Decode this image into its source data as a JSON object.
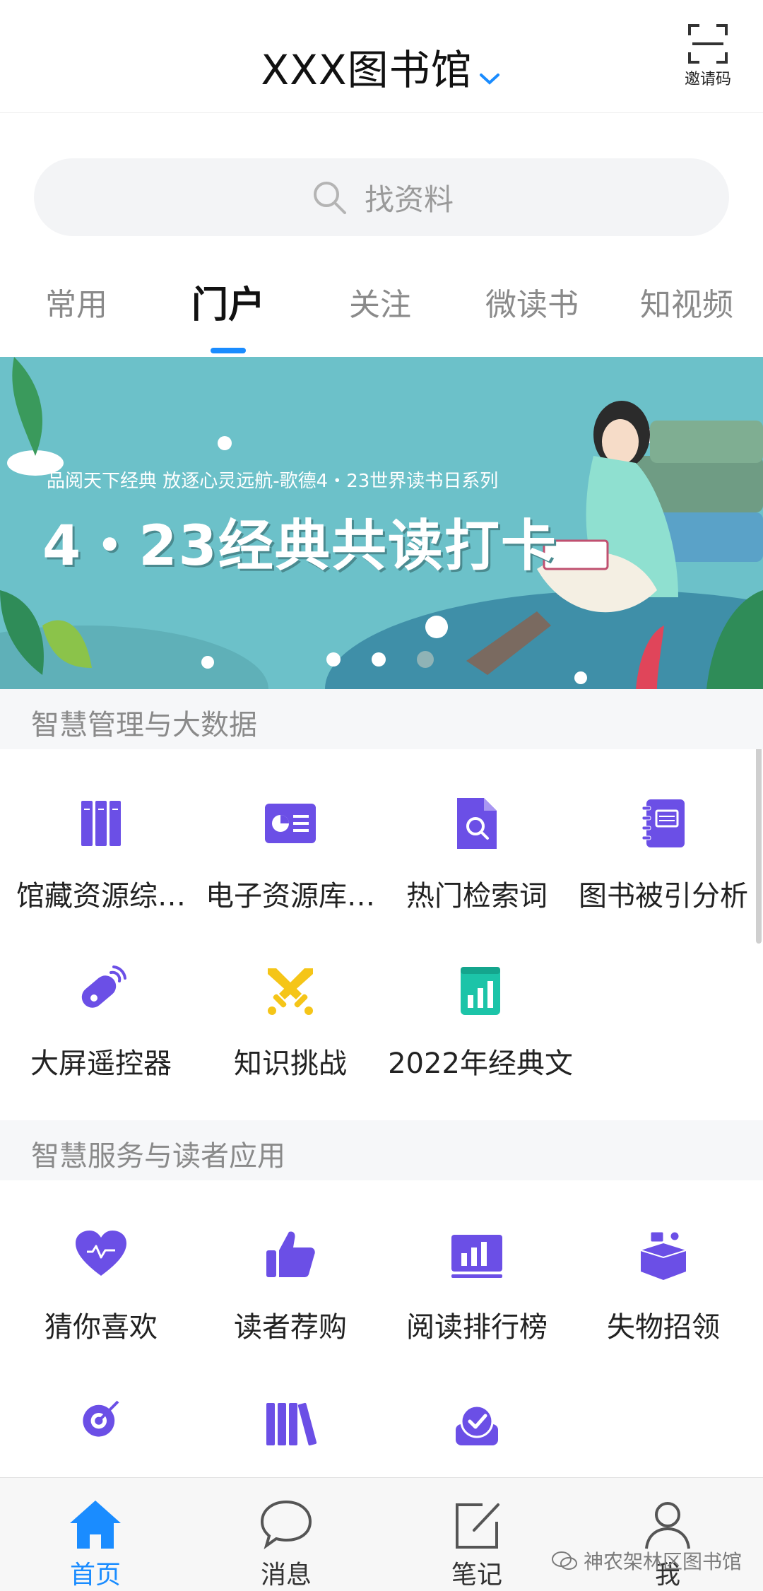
{
  "header": {
    "title": "XXX图书馆",
    "invite_label": "邀请码"
  },
  "search": {
    "placeholder": "找资料"
  },
  "tabs": [
    {
      "label": "常用"
    },
    {
      "label": "门户"
    },
    {
      "label": "关注"
    },
    {
      "label": "微读书"
    },
    {
      "label": "知视频"
    }
  ],
  "active_tab": "门户",
  "banner": {
    "subtitle": "品阅天下经典 放逐心灵远航-歌德4・23世界读书日系列",
    "title": "4・23经典共读打卡",
    "slide_count": 3,
    "active_slide": 1
  },
  "sections": [
    {
      "title": "智慧管理与大数据",
      "items": [
        {
          "label": "馆藏资源综…",
          "icon": "bookshelf-icon"
        },
        {
          "label": "电子资源库…",
          "icon": "pie-chart-card-icon"
        },
        {
          "label": "热门检索词",
          "icon": "document-search-icon"
        },
        {
          "label": "图书被引分析",
          "icon": "notebook-icon"
        },
        {
          "label": "大屏遥控器",
          "icon": "remote-control-icon"
        },
        {
          "label": "知识挑战",
          "icon": "crossed-swords-icon"
        },
        {
          "label": "2022年经典文",
          "icon": "bar-chart-book-icon"
        }
      ]
    },
    {
      "title": "智慧服务与读者应用",
      "items": [
        {
          "label": "猜你喜欢",
          "icon": "heart-icon"
        },
        {
          "label": "读者荐购",
          "icon": "thumbs-up-icon"
        },
        {
          "label": "阅读排行榜",
          "icon": "ranking-chart-icon"
        },
        {
          "label": "失物招领",
          "icon": "lost-found-box-icon"
        },
        {
          "label": "",
          "icon": "target-icon"
        },
        {
          "label": "",
          "icon": "books-icon"
        },
        {
          "label": "",
          "icon": "check-badge-icon"
        }
      ]
    }
  ],
  "bottom_nav": [
    {
      "label": "首页",
      "icon": "home-icon"
    },
    {
      "label": "消息",
      "icon": "chat-bubble-icon"
    },
    {
      "label": "笔记",
      "icon": "edit-note-icon"
    },
    {
      "label": "我",
      "icon": "user-icon"
    }
  ],
  "watermark": "神农架林区图书馆",
  "colors": {
    "accent": "#1a8cff",
    "icon_purple": "#6b4fe6",
    "icon_yellow": "#f5c518",
    "icon_teal": "#1cc4a8",
    "banner_bg": "#6cc1c9"
  }
}
